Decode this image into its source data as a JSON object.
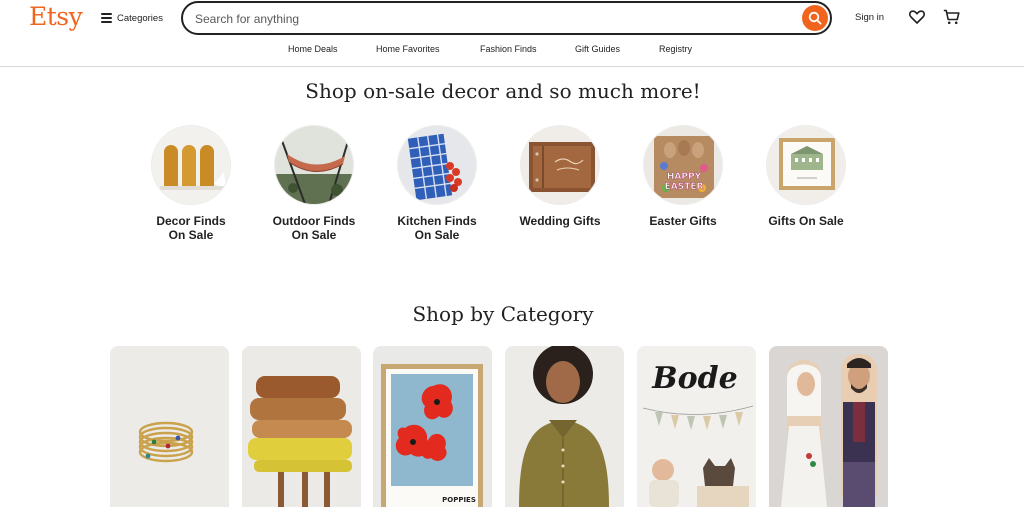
{
  "header": {
    "logo": "Etsy",
    "categories_label": "Categories",
    "search_placeholder": "Search for anything",
    "signin_label": "Sign in",
    "icons": [
      "menu-icon",
      "search-icon",
      "heart-icon",
      "cart-icon"
    ],
    "accent_color": "#f1641e"
  },
  "nav": {
    "items": [
      "Home Deals",
      "Home Favorites",
      "Fashion Finds",
      "Gift Guides",
      "Registry"
    ]
  },
  "sale_section": {
    "title": "Shop on-sale decor and so much more!",
    "items": [
      {
        "line1": "Decor Finds",
        "line2": "On Sale"
      },
      {
        "line1": "Outdoor Finds",
        "line2": "On Sale"
      },
      {
        "line1": "Kitchen Finds",
        "line2": "On Sale"
      },
      {
        "line1": "Wedding Gifts",
        "line2": ""
      },
      {
        "line1": "Easter Gifts",
        "line2": ""
      },
      {
        "line1": "Gifts On Sale",
        "line2": ""
      }
    ],
    "easter_image_text": [
      "HAPPY",
      "EASTER"
    ]
  },
  "category_section": {
    "title": "Shop by Category",
    "poster_text": "POPPIES",
    "sign_text": "Bode"
  }
}
